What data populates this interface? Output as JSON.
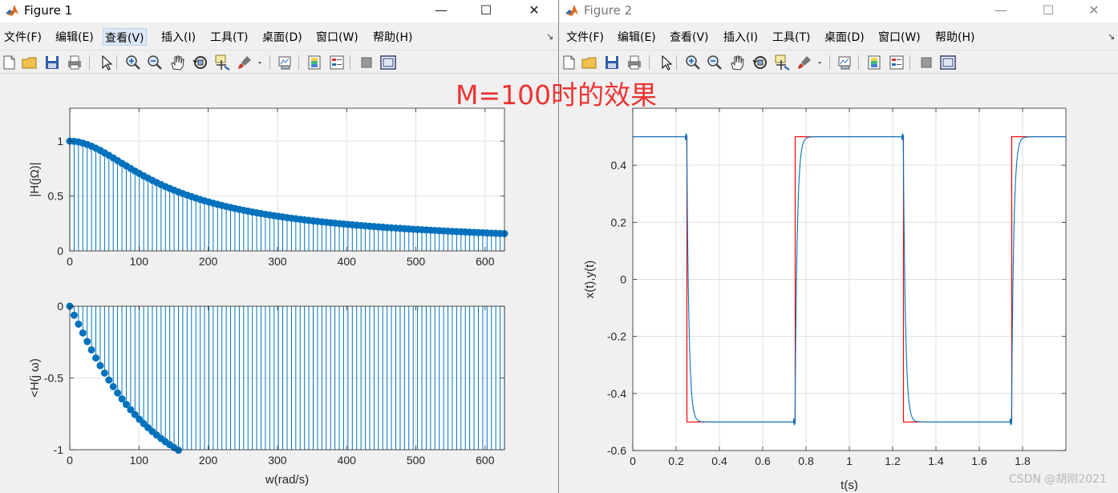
{
  "windows": [
    {
      "title": "Figure 1"
    },
    {
      "title": "Figure 2"
    }
  ],
  "window_controls": {
    "minimize": "—",
    "maximize": "☐",
    "close": "✕"
  },
  "menu": [
    "文件(F)",
    "编辑(E)",
    "查看(V)",
    "插入(I)",
    "工具(T)",
    "桌面(D)",
    "窗口(W)",
    "帮助(H)"
  ],
  "dock_arrow": "↘",
  "toolbar_icons": [
    "new-figure-icon",
    "open-icon",
    "save-icon",
    "print-icon",
    "pointer-icon",
    "zoom-in-icon",
    "zoom-out-icon",
    "pan-icon",
    "rotate-3d-icon",
    "data-cursor-icon",
    "brush-icon",
    "brush-dropdown-icon",
    "link-plot-icon",
    "colorbar-icon",
    "legend-icon",
    "hide-plot-tools-icon",
    "show-plot-tools-icon"
  ],
  "annotation": "M=100时的效果",
  "watermark": "CSDN @胡刚2021",
  "colors": {
    "stem": "#0072bd",
    "input": "#ff0000",
    "output": "#0072bd",
    "annotation": "#ee3333"
  },
  "chart_data": [
    {
      "type": "stem",
      "ylabel": "|H(jΩ)|",
      "xlabel": "",
      "xlim": [
        0,
        628
      ],
      "ylim": [
        0,
        1.3
      ],
      "xticks": [
        0,
        100,
        200,
        300,
        400,
        500,
        600
      ],
      "yticks": [
        0,
        0.5,
        1
      ],
      "x_step": 6.28,
      "function": "1/sqrt(1+(w/100)^2)",
      "samples": [
        [
          0,
          1.0
        ],
        [
          50,
          0.894
        ],
        [
          100,
          0.707
        ],
        [
          200,
          0.447
        ],
        [
          300,
          0.316
        ],
        [
          400,
          0.243
        ],
        [
          500,
          0.196
        ],
        [
          600,
          0.164
        ],
        [
          628,
          0.157
        ]
      ],
      "grid": true
    },
    {
      "type": "stem",
      "ylabel": "<H(j ω)",
      "xlabel": "w(rad/s)",
      "xlim": [
        0,
        628
      ],
      "ylim": [
        -1,
        0
      ],
      "xticks": [
        0,
        100,
        200,
        300,
        400,
        500,
        600
      ],
      "yticks": [
        -1,
        -0.5,
        0
      ],
      "x_step": 6.28,
      "function": "-atan(w/100)",
      "samples": [
        [
          0,
          0
        ],
        [
          50,
          -0.464
        ],
        [
          100,
          -0.785
        ],
        [
          150,
          -0.983
        ]
      ],
      "clipped_below": -1,
      "grid": true
    },
    {
      "type": "line",
      "xlabel": "t(s)",
      "ylabel": "x(t),y(t)",
      "xlim": [
        0,
        2
      ],
      "ylim": [
        -0.6,
        0.6
      ],
      "xticks": [
        0,
        0.2,
        0.4,
        0.6,
        0.8,
        1,
        1.2,
        1.4,
        1.6,
        1.8
      ],
      "yticks": [
        -0.6,
        -0.4,
        -0.2,
        0,
        0.2,
        0.4
      ],
      "series": [
        {
          "name": "",
          "color": "#ff0000",
          "kind": "square",
          "amplitude": 0.5,
          "edges": [
            0.25,
            0.75,
            1.25,
            1.75
          ]
        },
        {
          "name": "",
          "color": "#0072bd",
          "kind": "filtered-square",
          "amplitude": 0.5,
          "time_constant": 0.01,
          "edges": [
            0.25,
            0.75,
            1.25,
            1.75
          ]
        }
      ],
      "grid": true
    }
  ]
}
